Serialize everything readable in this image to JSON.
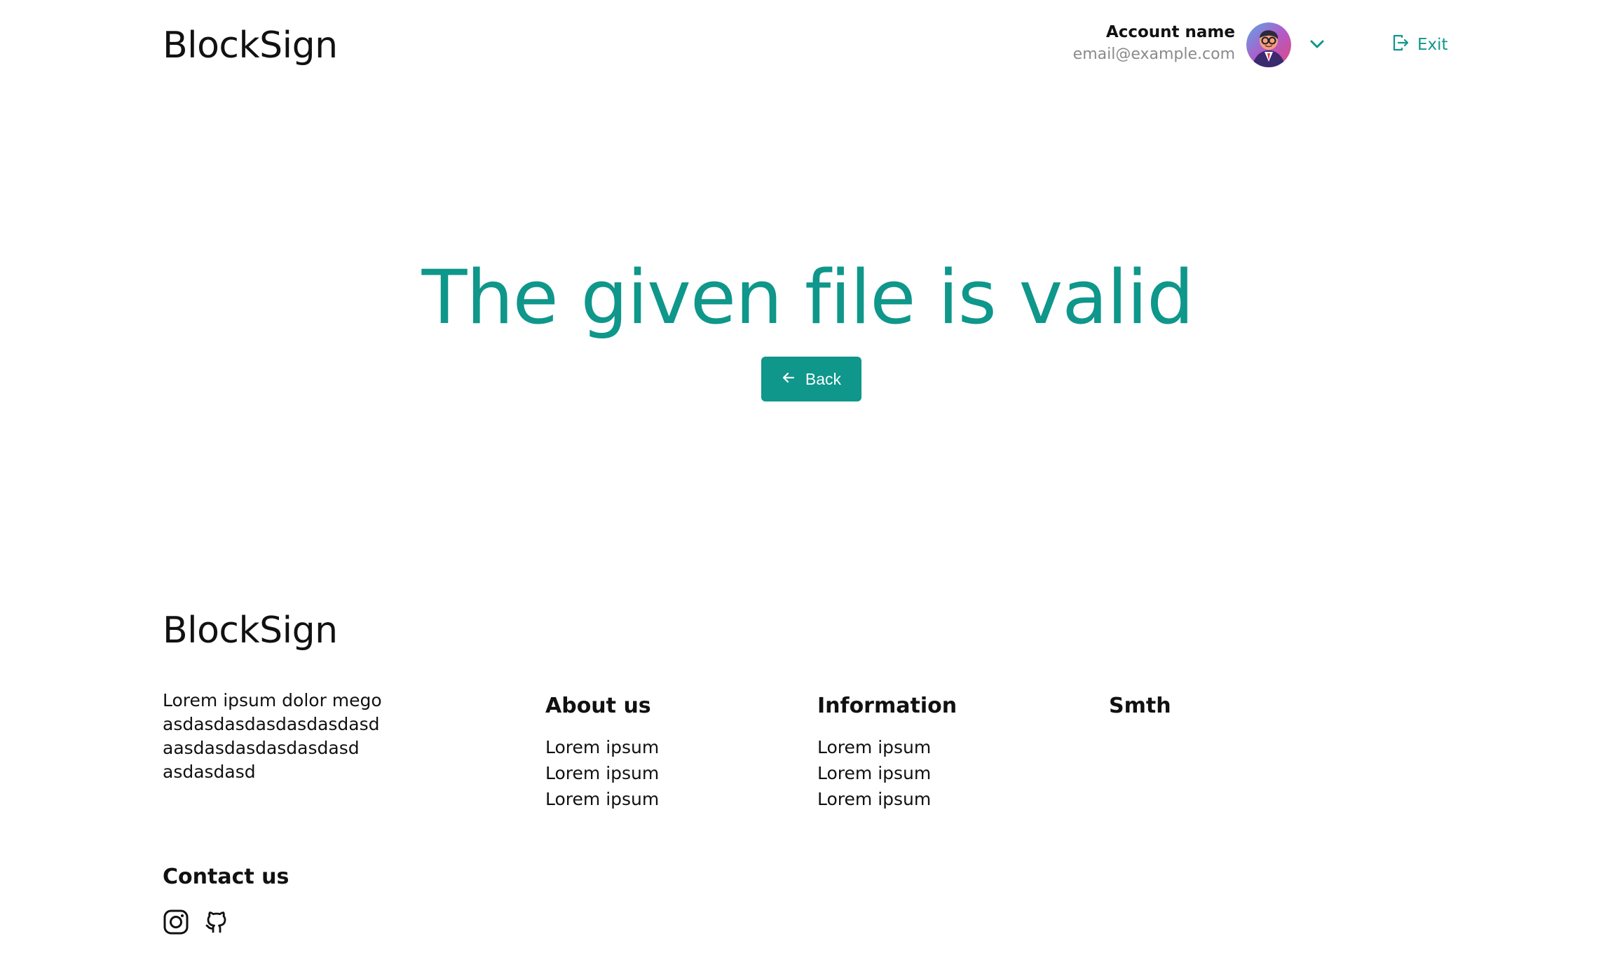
{
  "header": {
    "brand": "BlockSign",
    "account_name": "Account name",
    "account_email": "email@example.com",
    "exit_label": "Exit"
  },
  "main": {
    "title": "The given file is valid",
    "back_label": "Back"
  },
  "footer": {
    "brand": "BlockSign",
    "description_lines": [
      "Lorem ipsum dolor mego",
      "asdasdasdasdasdasdasd",
      "aasdasdasdasdasdasd",
      "asdasdasd"
    ],
    "columns": [
      {
        "title": "About us",
        "links": [
          "Lorem ipsum",
          "Lorem ipsum",
          "Lorem ipsum"
        ]
      },
      {
        "title": "Information",
        "links": [
          "Lorem ipsum",
          "Lorem ipsum",
          "Lorem ipsum"
        ]
      },
      {
        "title": "Smth",
        "links": []
      }
    ],
    "contact_title": "Contact us",
    "social_icons": [
      "instagram-icon",
      "github-icon"
    ]
  },
  "colors": {
    "accent": "#0e978a",
    "text": "#111111",
    "muted": "#8a8a8a",
    "background": "#ffffff"
  }
}
